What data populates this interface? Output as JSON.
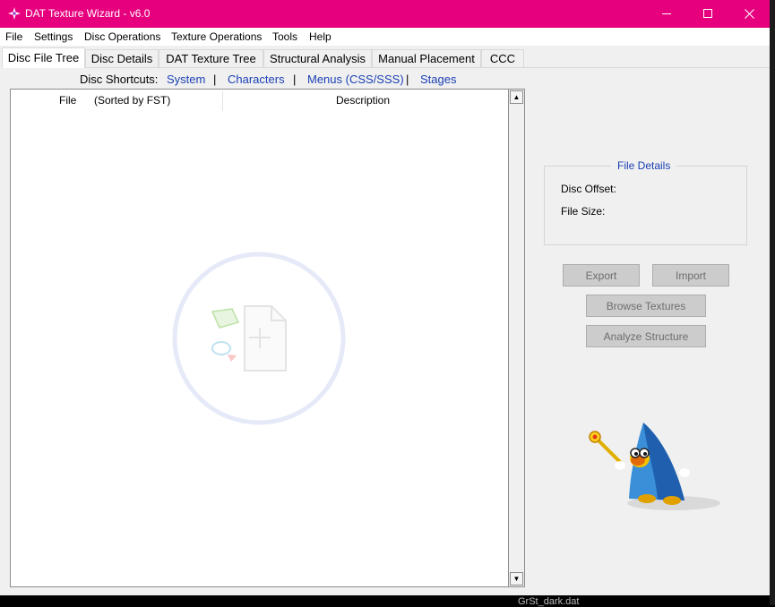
{
  "window": {
    "title": "DAT Texture Wizard - v6.0",
    "titlebar_color": "#e6007e",
    "app_icon": "star-icon",
    "controls": [
      "minimize-icon",
      "maximize-icon",
      "close-icon"
    ]
  },
  "menu": {
    "items": [
      "File",
      "Settings",
      "Disc Operations",
      "Texture Operations",
      "Tools",
      "Help"
    ]
  },
  "tabs": [
    "Disc File Tree",
    "Disc Details",
    "DAT Texture Tree",
    "Structural Analysis",
    "Manual Placement",
    "CCC"
  ],
  "shortcuts": {
    "label": "Disc Shortcuts:",
    "separator": "|",
    "links": [
      "System",
      "Characters",
      "Menus (CSS/SSS)",
      "Stages"
    ]
  },
  "tree": {
    "col_file": "File",
    "col_sorted": "(Sorted by FST)",
    "col_description": "Description",
    "drop_icon": "add-file-icon"
  },
  "file_details": {
    "title": "File Details",
    "disc_offset_label": "Disc Offset:",
    "file_size_label": "File Size:"
  },
  "buttons": {
    "export": "Export",
    "import": "Import",
    "browse_textures": "Browse Textures",
    "analyze_structure": "Analyze Structure"
  },
  "mascot_icon": "wizard-mascot-icon",
  "background_text": "GrSt_dark.dat",
  "colors": {
    "accent": "#e6007e",
    "link": "#1a3fb5"
  }
}
